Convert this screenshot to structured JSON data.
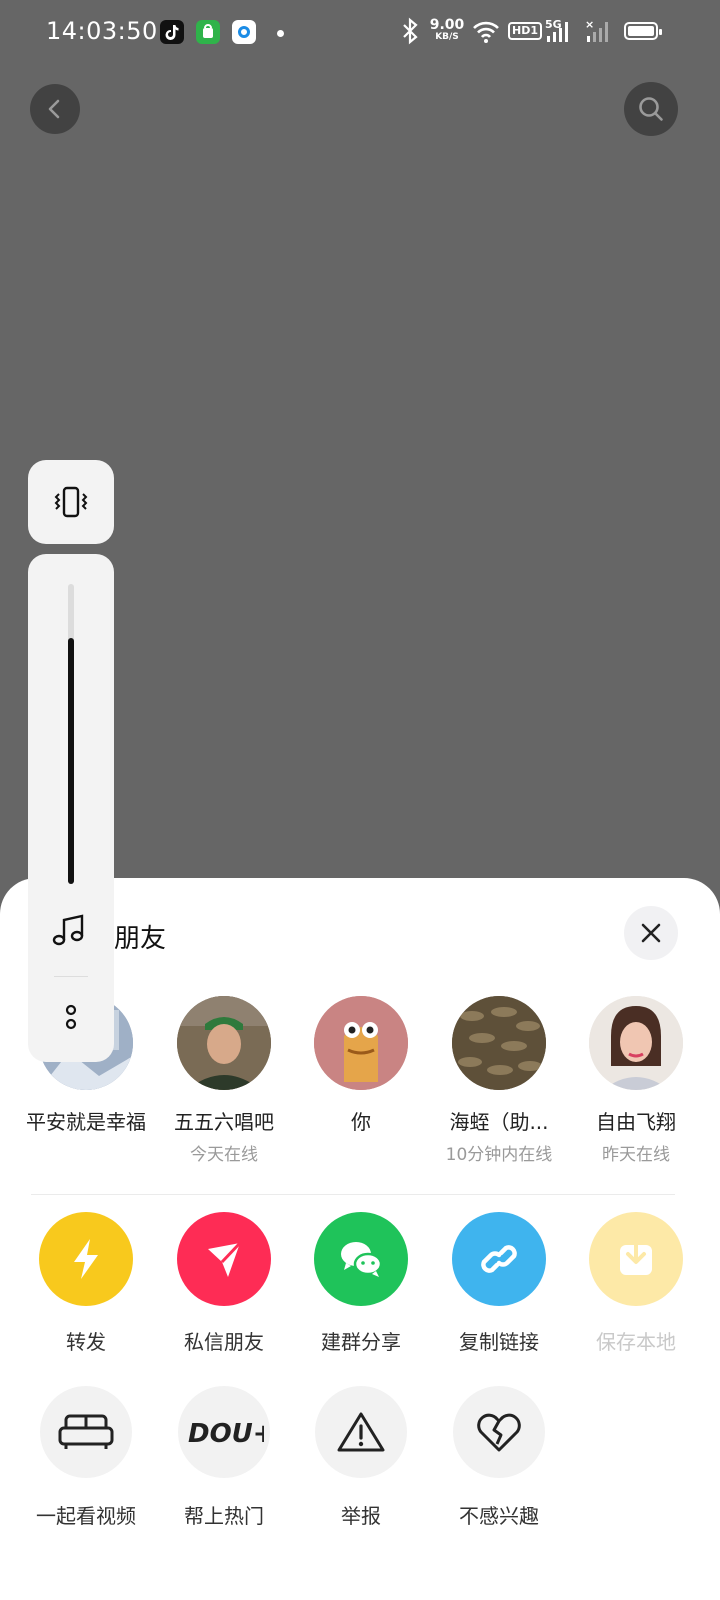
{
  "status_bar": {
    "time": "14:03:50",
    "net_speed": "9.00",
    "net_unit": "KB/S",
    "hd": "HD1",
    "signal_label": "5G"
  },
  "sheet": {
    "title": "朋友",
    "friends": [
      {
        "name": "平安就是幸福",
        "status": ""
      },
      {
        "name": "五五六唱吧",
        "status": "今天在线"
      },
      {
        "name": "你",
        "status": ""
      },
      {
        "name": "海蛭（助...",
        "status": "10分钟内在线"
      },
      {
        "name": "自由飞翔",
        "status": "昨天在线"
      }
    ],
    "share": [
      {
        "label": "转发",
        "color": "#f8c91d"
      },
      {
        "label": "私信朋友",
        "color": "#fe2c55"
      },
      {
        "label": "建群分享",
        "color": "#1fc35a"
      },
      {
        "label": "复制链接",
        "color": "#3fb4ee"
      },
      {
        "label": "保存本地",
        "color": "#fde9a7"
      }
    ],
    "actions": [
      {
        "label": "一起看视频"
      },
      {
        "label": "帮上热门",
        "logo_text": "DOU+"
      },
      {
        "label": "举报"
      },
      {
        "label": "不感兴趣"
      }
    ]
  },
  "volume": {
    "level": 0.82
  }
}
